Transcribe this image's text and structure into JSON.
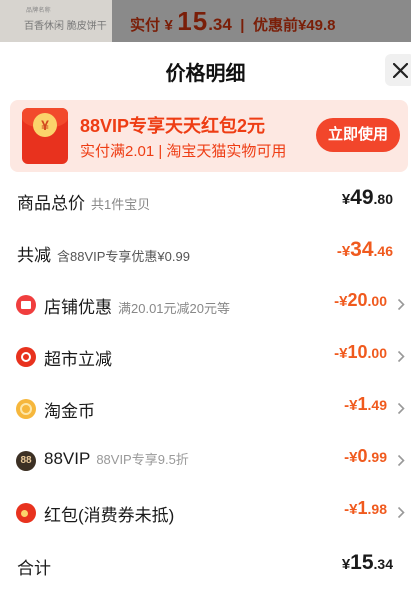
{
  "header": {
    "thumb_line1": "品牌名称",
    "thumb_line2": "百香休闲  脆皮饼干",
    "pay_label": "实付",
    "pay_currency": "¥",
    "pay_big": "15",
    "pay_small": ".34",
    "separator": "|",
    "orig_price_label": "优惠前¥49.8"
  },
  "sheet": {
    "title": "价格明细",
    "close_icon": "close-icon"
  },
  "banner": {
    "icon": "red-envelope-icon",
    "coin_symbol": "¥",
    "title": "88VIP专享天天红包2元",
    "subtitle": "实付满2.01 | 淘宝天猫实物可用",
    "button_label": "立即使用"
  },
  "rows": {
    "total": {
      "label": "商品总价",
      "note": "共1件宝贝",
      "currency": "¥",
      "int": "49",
      "dec": ".80"
    },
    "reduction": {
      "label": "共减",
      "note": "含88VIP专享优惠¥0.99",
      "prefix": "-¥",
      "int": "34",
      "dec": ".46"
    },
    "shop": {
      "icon": "shop-discount-icon",
      "label": "店铺优惠",
      "note": "满20.01元减20元等",
      "prefix": "-¥",
      "int": "20",
      "dec": ".00"
    },
    "market": {
      "icon": "supermarket-icon",
      "label": "超市立减",
      "prefix": "-¥",
      "int": "10",
      "dec": ".00"
    },
    "coin": {
      "icon": "taojinbi-coin-icon",
      "label": "淘金币",
      "prefix": "-¥",
      "int": "1",
      "dec": ".49"
    },
    "vip": {
      "icon": "vip-88-icon",
      "icon_text": "88",
      "label": "88VIP",
      "note": "88VIP专享9.5折",
      "prefix": "-¥",
      "int": "0",
      "dec": ".99"
    },
    "hongbao": {
      "icon": "red-packet-icon",
      "label": "红包(消费券未抵)",
      "prefix": "-¥",
      "int": "1",
      "dec": ".98"
    },
    "sum": {
      "label": "合计",
      "currency": "¥",
      "int": "15",
      "dec": ".34"
    }
  },
  "colors": {
    "accent": "#f2462b",
    "discount": "#f05a1e",
    "banner_bg": "#fde8e2"
  }
}
